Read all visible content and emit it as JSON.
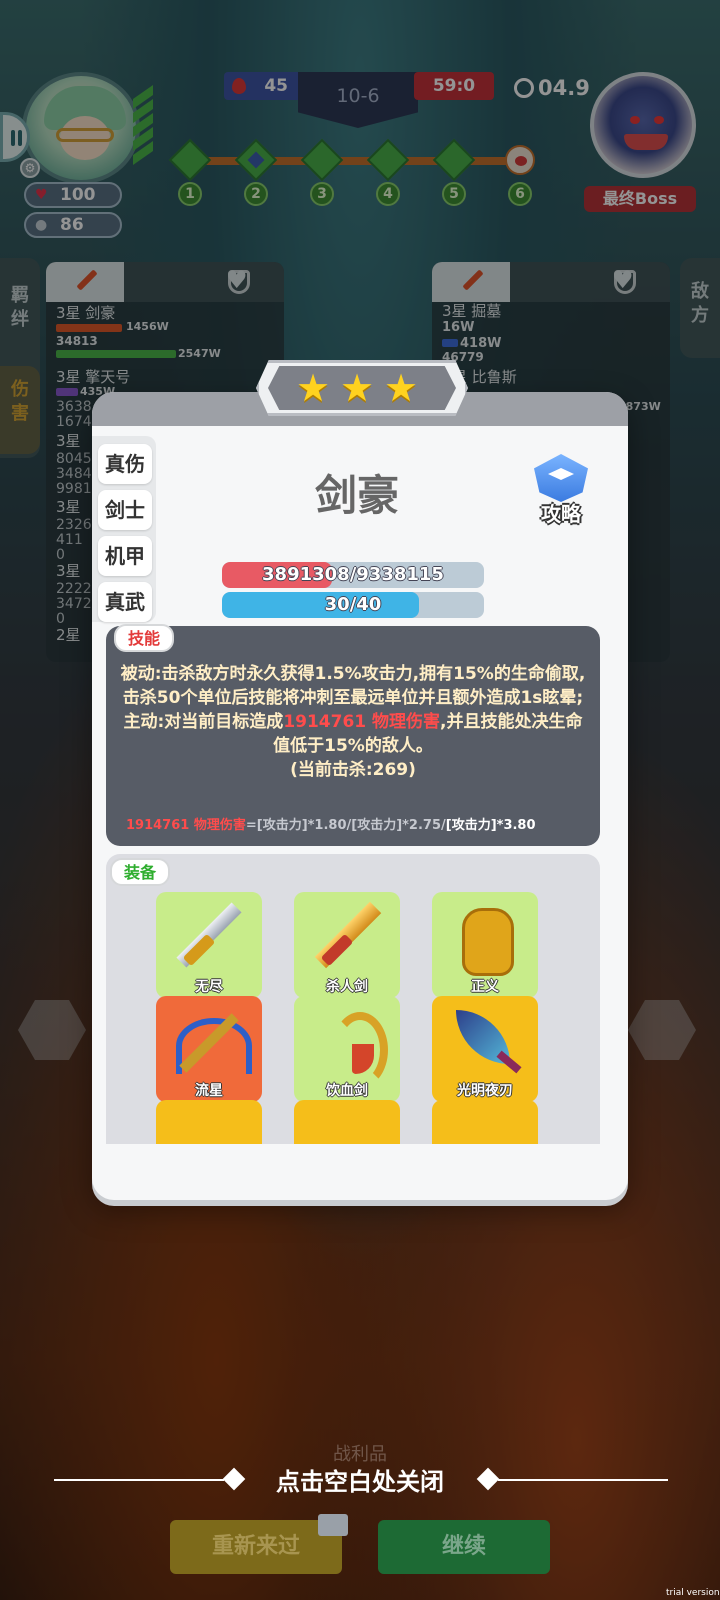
{
  "hud": {
    "player_hp": "100",
    "player_coins": "86",
    "blood_count": "45",
    "stage": "10-6",
    "score": "59:0",
    "timer": "04.9",
    "boss_label": "最终Boss",
    "waves": [
      "1",
      "2",
      "3",
      "4",
      "5",
      "6"
    ]
  },
  "side": {
    "left_tab_1": "羁绊",
    "left_tab_2": "伤害",
    "right_tab": "敌方"
  },
  "left_panel": {
    "units": [
      {
        "name": "3星 剑豪",
        "bar1": "1456W",
        "val": "34813",
        "bar2": "2547W"
      },
      {
        "name": "3星 擎天号",
        "bar1": "435W",
        "val": "3638",
        "val2": "1674"
      },
      {
        "name": "3星",
        "l1": "8045",
        "l2": "3484",
        "l3": "9981"
      },
      {
        "name": "3星",
        "l1": "2326",
        "l2": "411",
        "l3": "0"
      },
      {
        "name": "3星",
        "l1": "2222",
        "l2": "3472",
        "l3": "0"
      },
      {
        "name": "2星"
      }
    ]
  },
  "right_panel": {
    "units": [
      {
        "name": "3星 掘墓",
        "val": "16W",
        "bar1": "418W",
        "val2": "46779"
      },
      {
        "name": "星 比鲁斯",
        "extra": "3873W"
      }
    ]
  },
  "modal": {
    "stars": 3,
    "tabs": [
      "真伤",
      "剑士",
      "机甲",
      "真武"
    ],
    "hero_name": "剑豪",
    "guide_label": "攻略",
    "hp_text": "3891308/9338115",
    "hp_ratio": 0.42,
    "mp_text": "30/40",
    "mp_ratio": 0.75,
    "skill": {
      "tag": "技能",
      "passive": "被动:击杀敌方时永久获得1.5%攻击力,拥有15%的生命偷取,击杀50个单位后技能将冲刺至最远单位并且额外造成1s眩晕;",
      "active_prefix": "主动:对当前目标造成",
      "active_damage": "1914761 物理伤害",
      "active_suffix": ",并且技能处决生命值低于15%的敌人。",
      "kills": "(当前击杀:269)",
      "formula_red": "1914761 物理伤害",
      "formula_mid": "=[攻击力]*1.80/[攻击力]*2.75/",
      "formula_end": "[攻击力]*3.80"
    },
    "equip": {
      "tag": "装备",
      "items": [
        "无尽",
        "杀人剑",
        "正义",
        "流星",
        "饮血剑",
        "光明夜刃"
      ]
    }
  },
  "bottom": {
    "loot_tab": "战利品",
    "close_hint": "点击空白处关闭",
    "retry": "重新来过",
    "continue": "继续",
    "trial": "trial version"
  },
  "colors": {
    "hp": "#e85a64",
    "mp": "#3fb4e6",
    "equip_green": "#c8ec8a",
    "equip_red": "#f06a3a",
    "equip_gold": "#f5be1a"
  }
}
